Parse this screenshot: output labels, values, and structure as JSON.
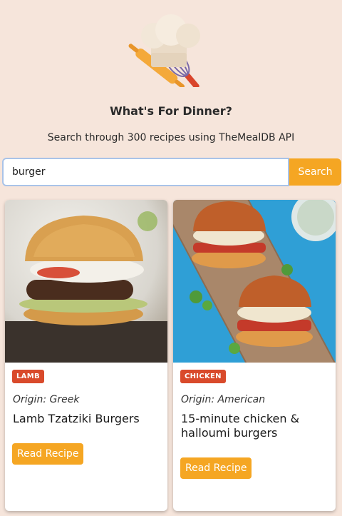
{
  "header": {
    "logo_icon": "chef-hat-rolling-pin-whisk-icon",
    "title": "What's For Dinner?",
    "subtitle": "Search through 300 recipes using TheMealDB API"
  },
  "search": {
    "value": "burger",
    "button_label": "Search"
  },
  "recipes": [
    {
      "category": "LAMB",
      "origin": "Origin: Greek",
      "title": "Lamb Tzatziki Burgers",
      "button_label": "Read Recipe"
    },
    {
      "category": "CHICKEN",
      "origin": "Origin: American",
      "title": "15-minute chicken & halloumi burgers",
      "button_label": "Read Recipe"
    }
  ],
  "colors": {
    "background": "#f6e5db",
    "accent": "#f5a623",
    "badge": "#d94a2b"
  }
}
